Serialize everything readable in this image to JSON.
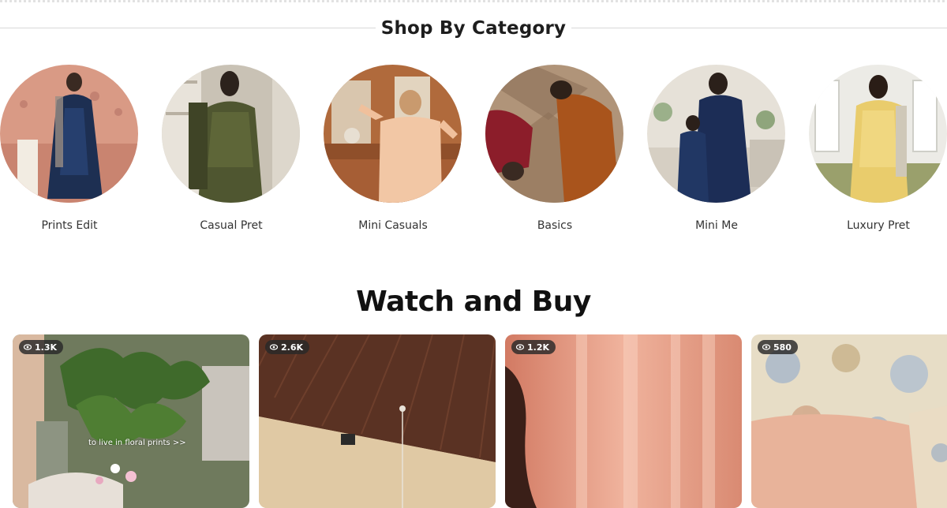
{
  "section_title": "Shop By Category",
  "categories": [
    {
      "label": "Prints Edit"
    },
    {
      "label": "Casual Pret"
    },
    {
      "label": "Mini Casuals"
    },
    {
      "label": "Basics"
    },
    {
      "label": "Mini Me"
    },
    {
      "label": "Luxury Pret"
    }
  ],
  "watch_title": "Watch and Buy",
  "videos": [
    {
      "views": "1.3K",
      "caption": "to live in floral prints >>"
    },
    {
      "views": "2.6K"
    },
    {
      "views": "1.2K"
    },
    {
      "views": "580"
    }
  ],
  "icons": {
    "views": "eye-icon"
  },
  "colors": {
    "heading": "#1e1e1e",
    "badge_bg": "#282828"
  }
}
